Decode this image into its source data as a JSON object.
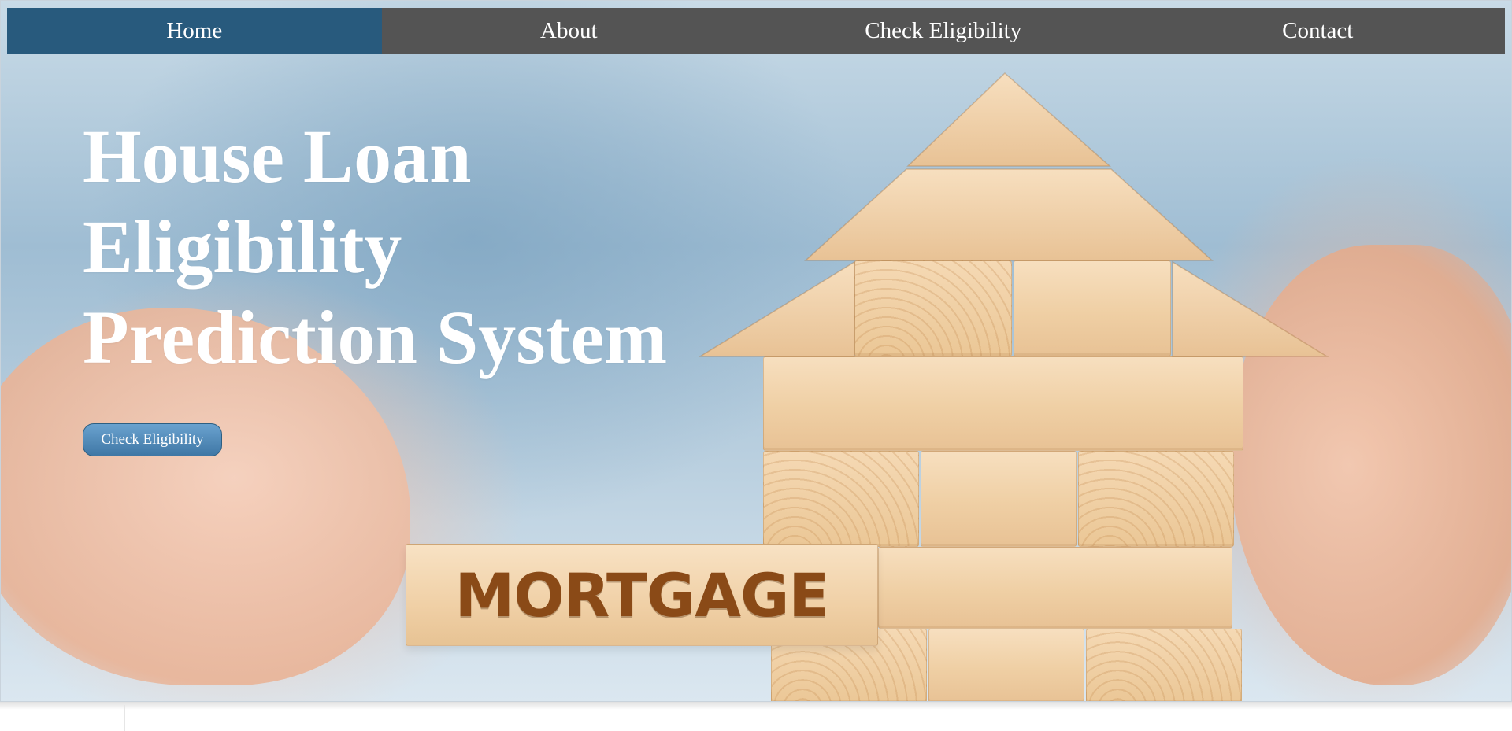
{
  "nav": {
    "items": [
      {
        "label": "Home",
        "active": true
      },
      {
        "label": "About",
        "active": false
      },
      {
        "label": "Check Eligibility",
        "active": false
      },
      {
        "label": "Contact",
        "active": false
      }
    ]
  },
  "hero": {
    "title_lines": [
      "House Loan",
      "Eligibility",
      "Prediction System"
    ],
    "cta_label": "Check Eligibility",
    "image_block_text": "MORTGAGE"
  },
  "colors": {
    "nav_background": "#545454",
    "nav_active": "#285a7d",
    "cta_gradient_top": "#6aa2cf",
    "cta_gradient_bottom": "#3f77a5",
    "title_text": "#ffffff"
  }
}
